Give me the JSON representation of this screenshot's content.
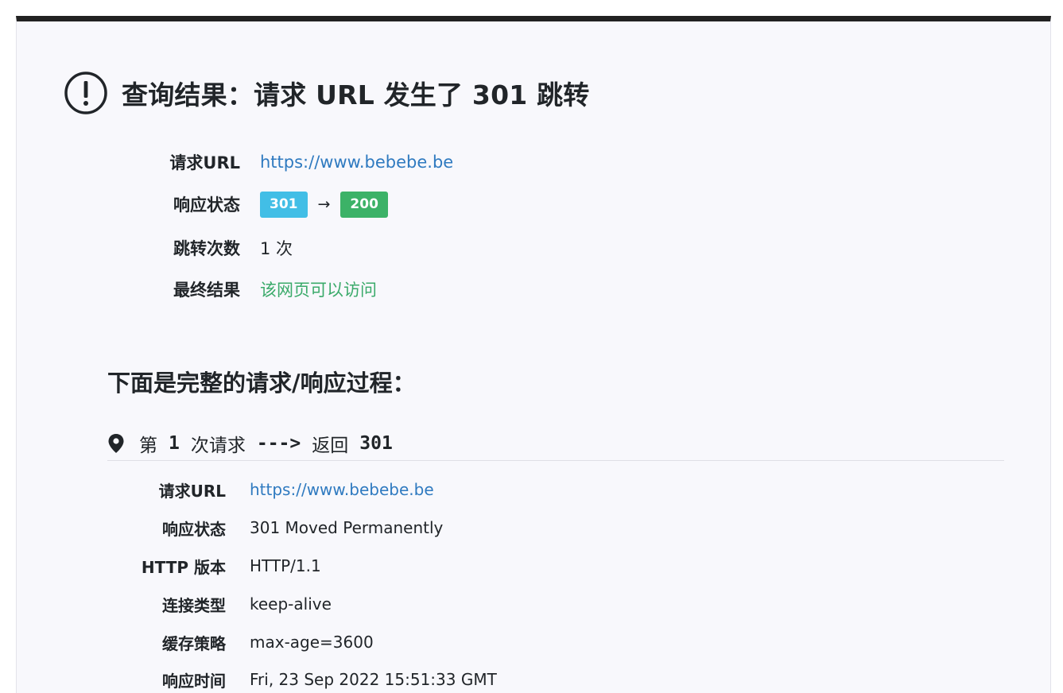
{
  "title": "查询结果：请求 URL 发生了 301 跳转",
  "summary": {
    "request_url_label": "请求URL",
    "request_url": "https://www.bebebe.be",
    "status_label": "响应状态",
    "status_from": "301",
    "status_arrow": "→",
    "status_to": "200",
    "redirects_label": "跳转次数",
    "redirects_value": "1 次",
    "final_label": "最终结果",
    "final_value": "该网页可以访问"
  },
  "process_title": "下面是完整的请求/响应过程：",
  "request": {
    "head_prefix": "第",
    "head_number": "1",
    "head_middle": "次请求",
    "head_arrow": "--->",
    "head_return": "返回",
    "head_code": "301",
    "rows": [
      {
        "label": "请求URL",
        "value": "https://www.bebebe.be",
        "link": true
      },
      {
        "label": "响应状态",
        "value": "301 Moved Permanently"
      },
      {
        "label": "HTTP 版本",
        "value": "HTTP/1.1"
      },
      {
        "label": "连接类型",
        "value": "keep-alive"
      },
      {
        "label": "缓存策略",
        "value": "max-age=3600"
      },
      {
        "label": "响应时间",
        "value": "Fri, 23 Sep 2022 15:51:33 GMT"
      }
    ]
  },
  "colors": {
    "link": "#2f7ac0",
    "success_text": "#3aaa6a",
    "badge_info": "#42bee6",
    "badge_success": "#3cb267"
  },
  "icons": {
    "title": "alert-circle-icon",
    "request_head": "map-pin-icon"
  }
}
